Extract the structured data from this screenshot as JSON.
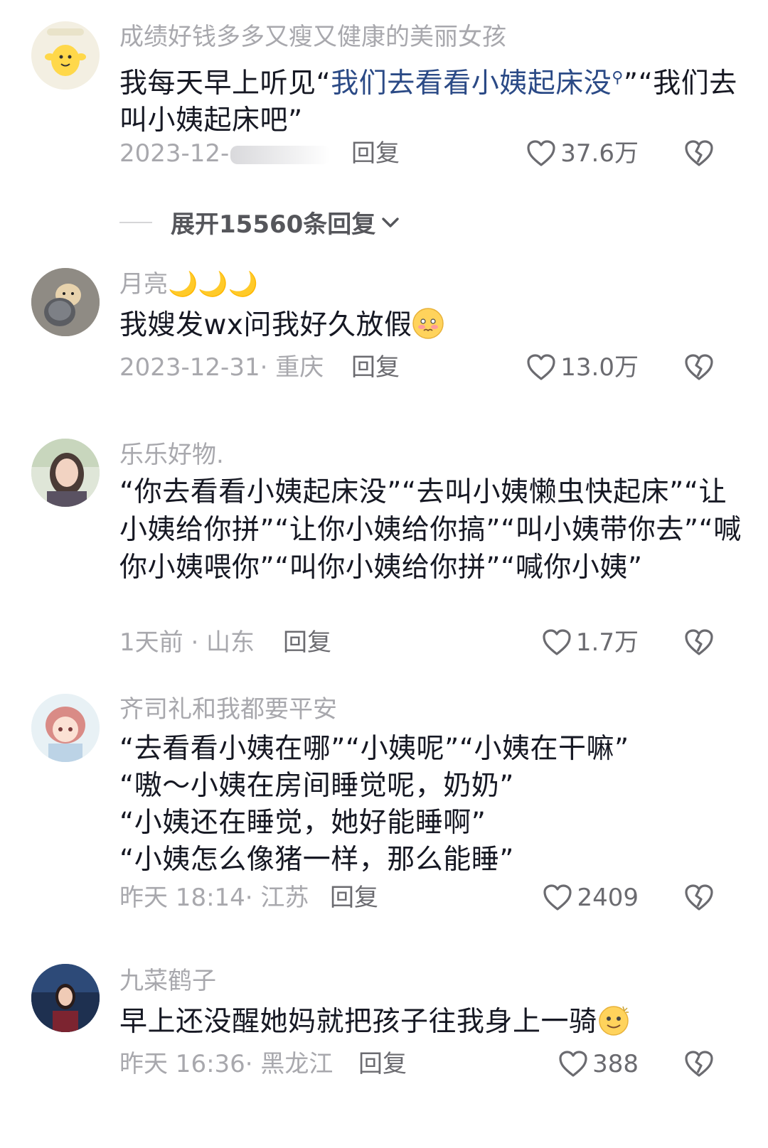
{
  "comments": [
    {
      "username": "成绩好钱多多又瘦又健康的美丽女孩",
      "text_prefix": "我每天早上听见“",
      "text_link": "我们去看看小姨起床没",
      "text_suffix": "”“我们去叫小姨起床吧”",
      "date": "2023-12-",
      "reply": "回复",
      "likes": "37.6万"
    },
    {
      "username": "月亮🌙🌙🌙",
      "text": "我嫂发wx问我好久放假",
      "date": "2023-12-31· 重庆",
      "reply": "回复",
      "likes": "13.0万"
    },
    {
      "username": "乐乐好物.",
      "text": "“你去看看小姨起床没”“去叫小姨懒虫快起床”“让小姨给你拼”“让你小姨给你搞”“叫小姨带你去”“喊你小姨喂你”“叫你小姨给你拼”“喊你小姨”",
      "date": "1天前 · 山东",
      "reply": "回复",
      "likes": "1.7万"
    },
    {
      "username": "齐司礼和我都要平安",
      "lines": [
        "“去看看小姨在哪”“小姨呢”“小姨在干嘛”",
        "“嗷～小姨在房间睡觉呢，奶奶”",
        "“小姨还在睡觉，她好能睡啊”",
        "“小姨怎么像猪一样，那么能睡”"
      ],
      "date": "昨天 18:14· 江苏",
      "reply": "回复",
      "likes": "2409"
    },
    {
      "username": "九菜鹤子",
      "text": "早上还没醒她妈就把孩子往我身上一骑",
      "date": "昨天 16:36· 黑龙江",
      "reply": "回复",
      "likes": "388"
    }
  ],
  "expand_replies": "展开15560条回复",
  "icons": {
    "like": "heart-outline-icon",
    "dislike": "broken-heart-icon",
    "expand": "chevron-down-icon"
  },
  "colors": {
    "username": "#a8a8ad",
    "link": "#2b4a86",
    "text": "#161823"
  }
}
